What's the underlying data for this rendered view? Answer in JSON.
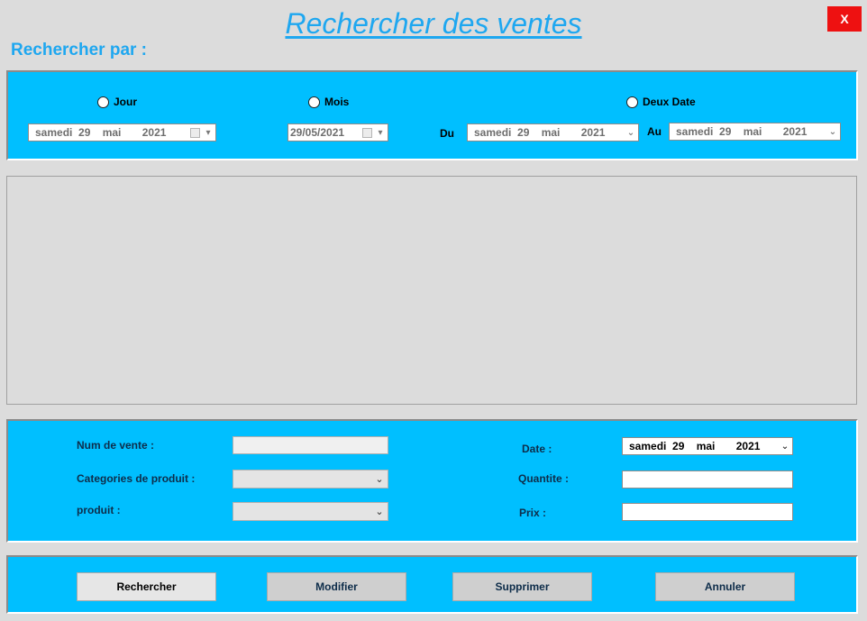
{
  "window": {
    "title": "Rechercher des ventes",
    "close_label": "X"
  },
  "search_by_label": "Rechercher par :",
  "filters": {
    "jour": {
      "label": "Jour",
      "date": "samedi  29    mai       2021"
    },
    "mois": {
      "label": "Mois",
      "date": "29/05/2021"
    },
    "deux_date": {
      "label": "Deux Date",
      "from_label": "Du",
      "from_date": "samedi  29    mai       2021",
      "to_label": "Au",
      "to_date": "samedi  29    mai       2021"
    }
  },
  "form": {
    "num_vente_label": "Num de vente :",
    "num_vente_value": "",
    "categorie_label": "Categories de produit :",
    "categorie_value": "",
    "produit_label": "produit :",
    "produit_value": "",
    "date_label": "Date :",
    "date_value": "samedi  29    mai       2021",
    "quantite_label": "Quantite :",
    "quantite_value": "",
    "prix_label": "Prix :",
    "prix_value": ""
  },
  "actions": {
    "rechercher": "Rechercher",
    "modifier": "Modifier",
    "supprimer": "Supprimer",
    "annuler": "Annuler"
  },
  "icons": {
    "radio": "radio-button",
    "calendar": "calendar-icon",
    "dropdown": "chevron-down-icon"
  },
  "colors": {
    "accent": "#00bfff",
    "title": "#1ea7f0",
    "close": "#ee1111",
    "background": "#dcdcdc"
  }
}
